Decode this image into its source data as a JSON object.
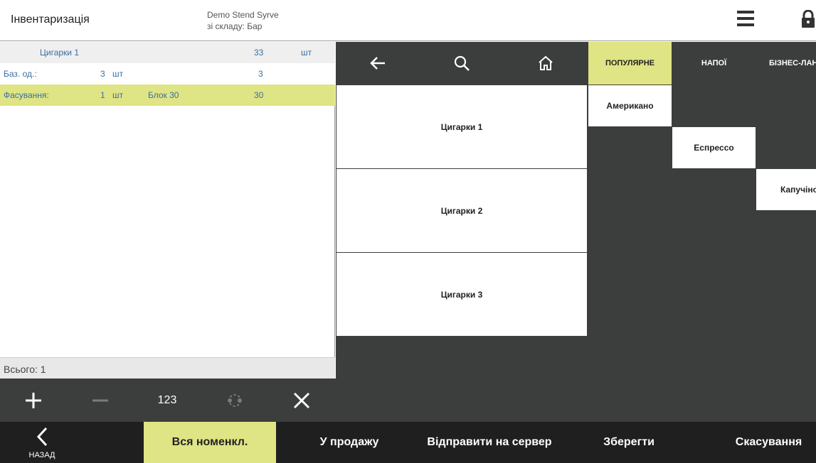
{
  "header": {
    "title": "Інвентаризація",
    "org_name": "Demo Stend Syrve",
    "warehouse": "зі складу: Бар"
  },
  "inventory": {
    "product_row": {
      "name": "Цигарки 1",
      "qty": "33",
      "unit": "шт"
    },
    "base_row": {
      "label": "Баз. од.:",
      "qty": "3",
      "unit": "шт",
      "total": "3"
    },
    "pack_row": {
      "label": "Фасування:",
      "qty": "1",
      "unit": "шт",
      "pack_name": "Блок 30",
      "total": "30"
    },
    "total_label": "Всього: 1"
  },
  "left_toolbar": {
    "numpad_label": "123"
  },
  "categories": {
    "tabs": [
      {
        "label": "ПОПУЛЯРНЕ",
        "active": true
      },
      {
        "label": "НАПОЇ",
        "active": false
      },
      {
        "label": "БІЗНЕС-ЛАНЧ",
        "active": false
      }
    ]
  },
  "products": [
    "Цигарки 1",
    "Цигарки 2",
    "Цигарки 3"
  ],
  "popular_items": [
    "Американо",
    "Еспрессо",
    "Капучіно"
  ],
  "bottom_bar": {
    "back_label": "НАЗАД",
    "all_items": "Вся номенкл.",
    "for_sale": "У продажу",
    "send_to_server": "Відправити на сервер",
    "save": "Зберегти",
    "cancel": "Скасування"
  },
  "colors": {
    "accent": "#dfe484",
    "dark": "#3c3d3d",
    "bottom_bar": "#1f1f1f",
    "link_text": "#3a6ea5"
  }
}
